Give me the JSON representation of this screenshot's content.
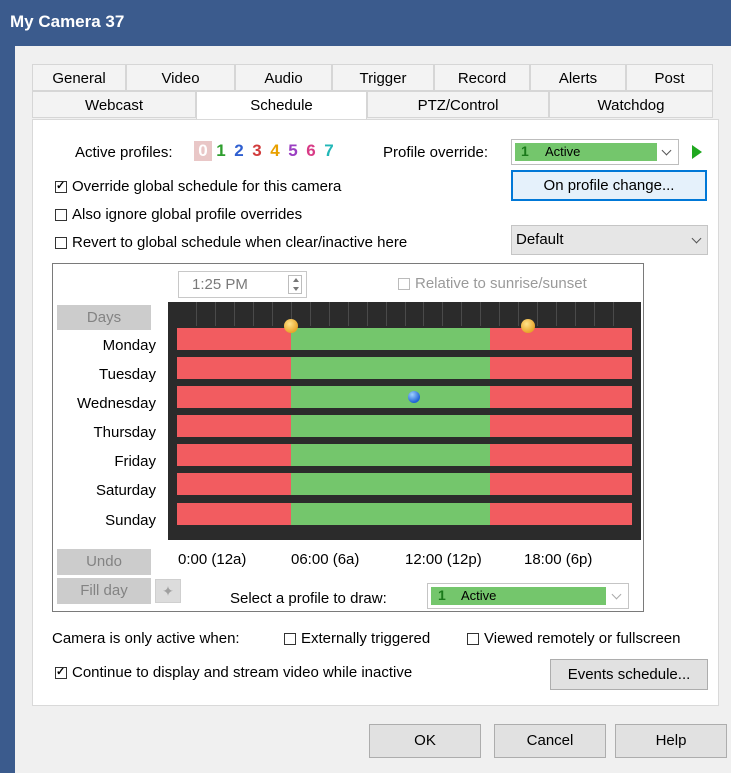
{
  "window": {
    "title": "My Camera 37"
  },
  "tabs_row1": [
    "General",
    "Video",
    "Audio",
    "Trigger",
    "Record",
    "Alerts",
    "Post"
  ],
  "tabs_row2": [
    "Webcast",
    "Schedule",
    "PTZ/Control",
    "Watchdog"
  ],
  "selected_tab": "Schedule",
  "profiles": {
    "label": "Active profiles:",
    "numbers": [
      "0",
      "1",
      "2",
      "3",
      "4",
      "5",
      "6",
      "7"
    ],
    "colors": [
      "#f4a6a6",
      "#2e9e2e",
      "#2f5fd0",
      "#d13b3b",
      "#e8a000",
      "#9b3fc2",
      "#d83b86",
      "#22b7b7"
    ],
    "override_label": "Profile override:",
    "override_value": "Active",
    "override_number": "1"
  },
  "buttons": {
    "on_profile_change": "On profile change...",
    "days": "Days",
    "undo": "Undo",
    "fill_day": "Fill day",
    "events_schedule": "Events schedule...",
    "ok": "OK",
    "cancel": "Cancel",
    "help": "Help"
  },
  "checkboxes": {
    "override_global": {
      "label": "Override global schedule for this camera",
      "checked": true
    },
    "ignore_global": {
      "label": "Also ignore global profile overrides",
      "checked": false
    },
    "revert_global": {
      "label": "Revert to global schedule when clear/inactive here",
      "checked": false
    },
    "relative_sun": {
      "label": "Relative to sunrise/sunset",
      "checked": false
    },
    "externally_triggered": {
      "label": "Externally triggered",
      "checked": false
    },
    "viewed_remotely": {
      "label": "Viewed remotely or fullscreen",
      "checked": false
    },
    "continue_display": {
      "label": "Continue to display and stream video while inactive",
      "checked": true
    }
  },
  "revert_select": {
    "value": "Default"
  },
  "schedule": {
    "time_value": "1:25 PM",
    "days": [
      "Monday",
      "Tuesday",
      "Wednesday",
      "Thursday",
      "Friday",
      "Saturday",
      "Sunday"
    ],
    "time_labels": [
      "0:00 (12a)",
      "06:00 (6a)",
      "12:00 (12p)",
      "18:00 (6p)"
    ],
    "inactive_color": "#f25c60",
    "active_color": "#74c66c",
    "active_start_hour": 6,
    "active_end_hour": 16.5,
    "current_marker": {
      "day": "Wednesday",
      "hour": 12.5
    },
    "sunrise_hour": 6,
    "sunset_hour": 18.5
  },
  "draw_profile": {
    "label": "Select a profile to draw:",
    "value": "Active",
    "number": "1"
  },
  "camera_active_label": "Camera is only active when:"
}
